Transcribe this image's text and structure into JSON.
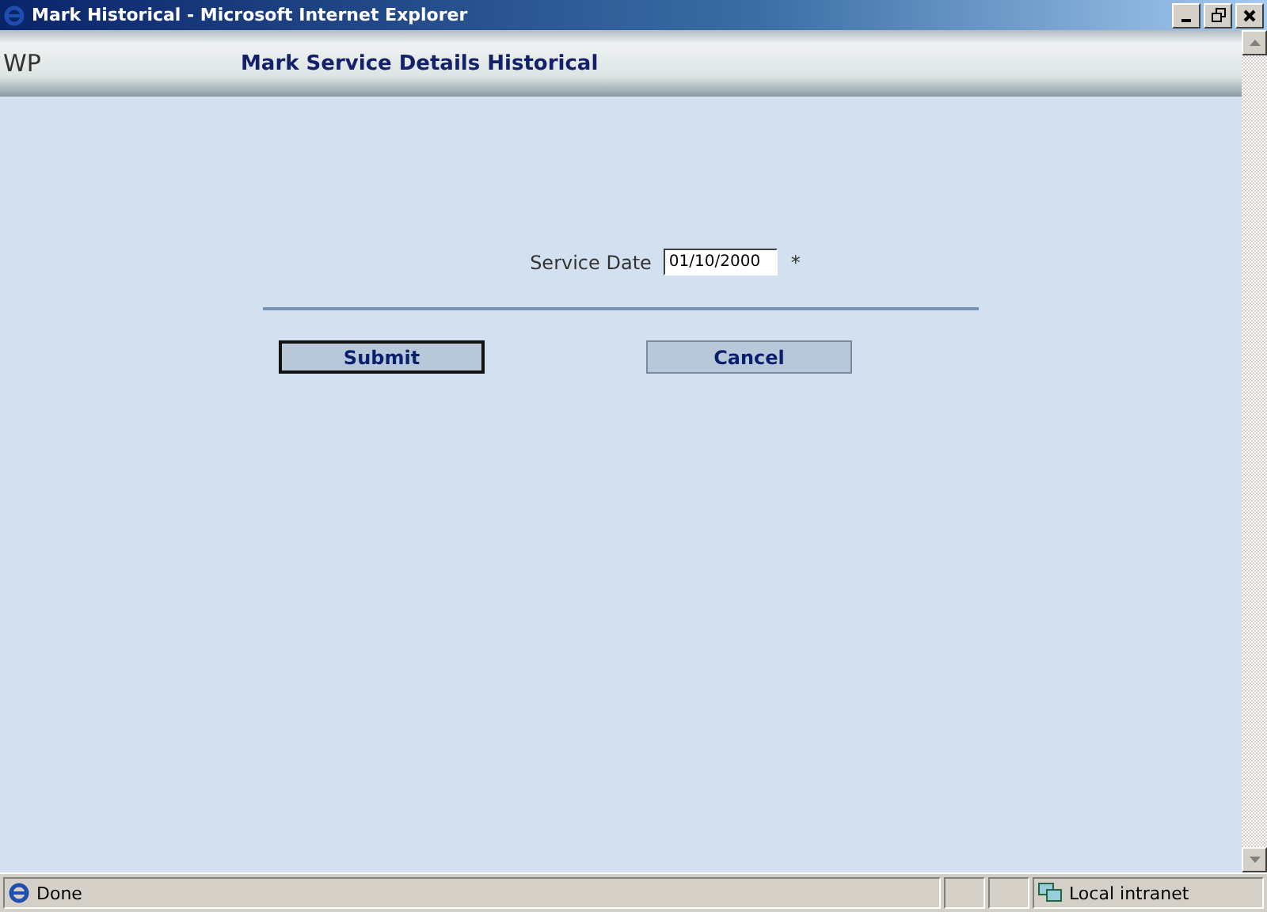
{
  "window": {
    "title": "Mark Historical - Microsoft Internet Explorer"
  },
  "header": {
    "logo": "WP",
    "title": "Mark Service Details Historical"
  },
  "form": {
    "label": "Service Date",
    "value": "01/10/2000",
    "required_mark": "*"
  },
  "buttons": [
    {
      "label": "Submit",
      "default": true
    },
    {
      "label": "Cancel",
      "default": false
    }
  ],
  "status_bar": {
    "text": "Done",
    "zone": "Local intranet"
  }
}
